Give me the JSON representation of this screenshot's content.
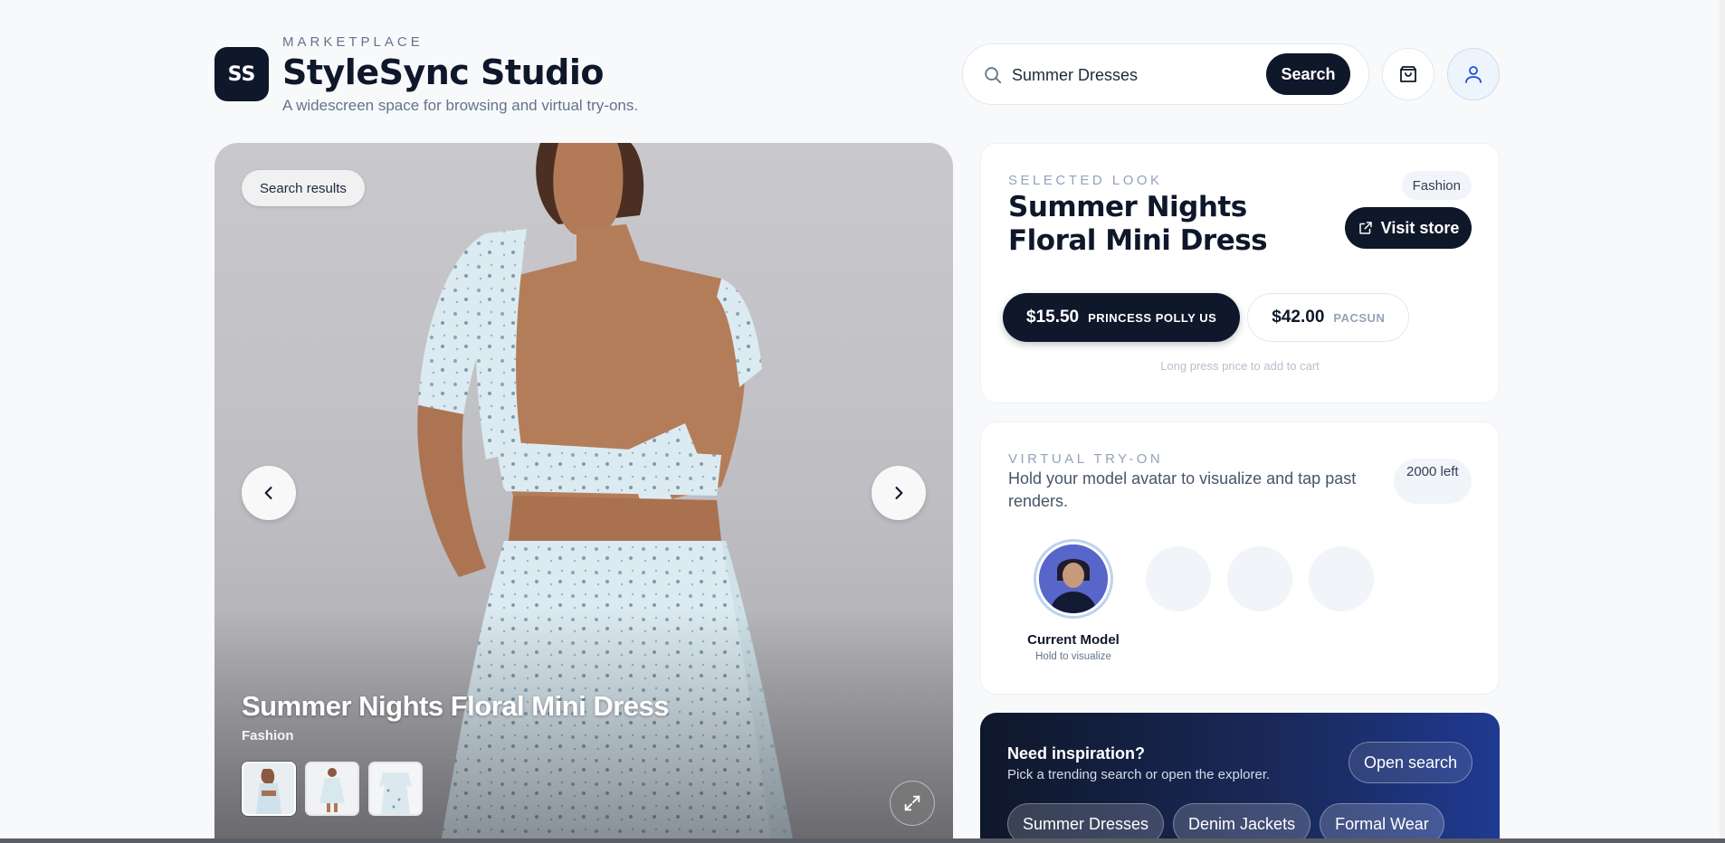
{
  "header": {
    "logo_text": "SS",
    "eyebrow": "MARKETPLACE",
    "title": "StyleSync Studio",
    "subtitle": "A widescreen space for browsing and virtual try-ons.",
    "search_value": "Summer Dresses",
    "search_button": "Search",
    "cart_icon": "shopping-bag-icon",
    "profile_icon": "user-icon"
  },
  "hero": {
    "badge": "Search results",
    "title": "Summer Nights Floral Mini Dress",
    "category": "Fashion",
    "thumbnails": [
      "back view",
      "front view",
      "front detail"
    ],
    "active_thumbnail": 0
  },
  "look": {
    "eyebrow": "SELECTED LOOK",
    "title": "Summer Nights Floral Mini Dress",
    "tag": "Fashion",
    "visit_label": "Visit store",
    "prices": [
      {
        "amount": "$15.50",
        "store": "PRINCESS POLLY US"
      },
      {
        "amount": "$42.00",
        "store": "PACSUN"
      }
    ],
    "hint": "Long press price to add to cart"
  },
  "tryon": {
    "eyebrow": "VIRTUAL TRY-ON",
    "description": "Hold your model avatar to visualize and tap past renders.",
    "remaining": "2000 left",
    "model_label": "Current Model",
    "model_hint": "Hold to visualize"
  },
  "inspiration": {
    "title": "Need inspiration?",
    "subtitle": "Pick a trending search or open the explorer.",
    "open_label": "Open search",
    "chips": [
      "Summer Dresses",
      "Denim Jackets",
      "Formal Wear"
    ]
  },
  "colors": {
    "primary": "#0f172a",
    "background": "#f7f9fb",
    "accent_gradient_end": "#1f3a91"
  }
}
